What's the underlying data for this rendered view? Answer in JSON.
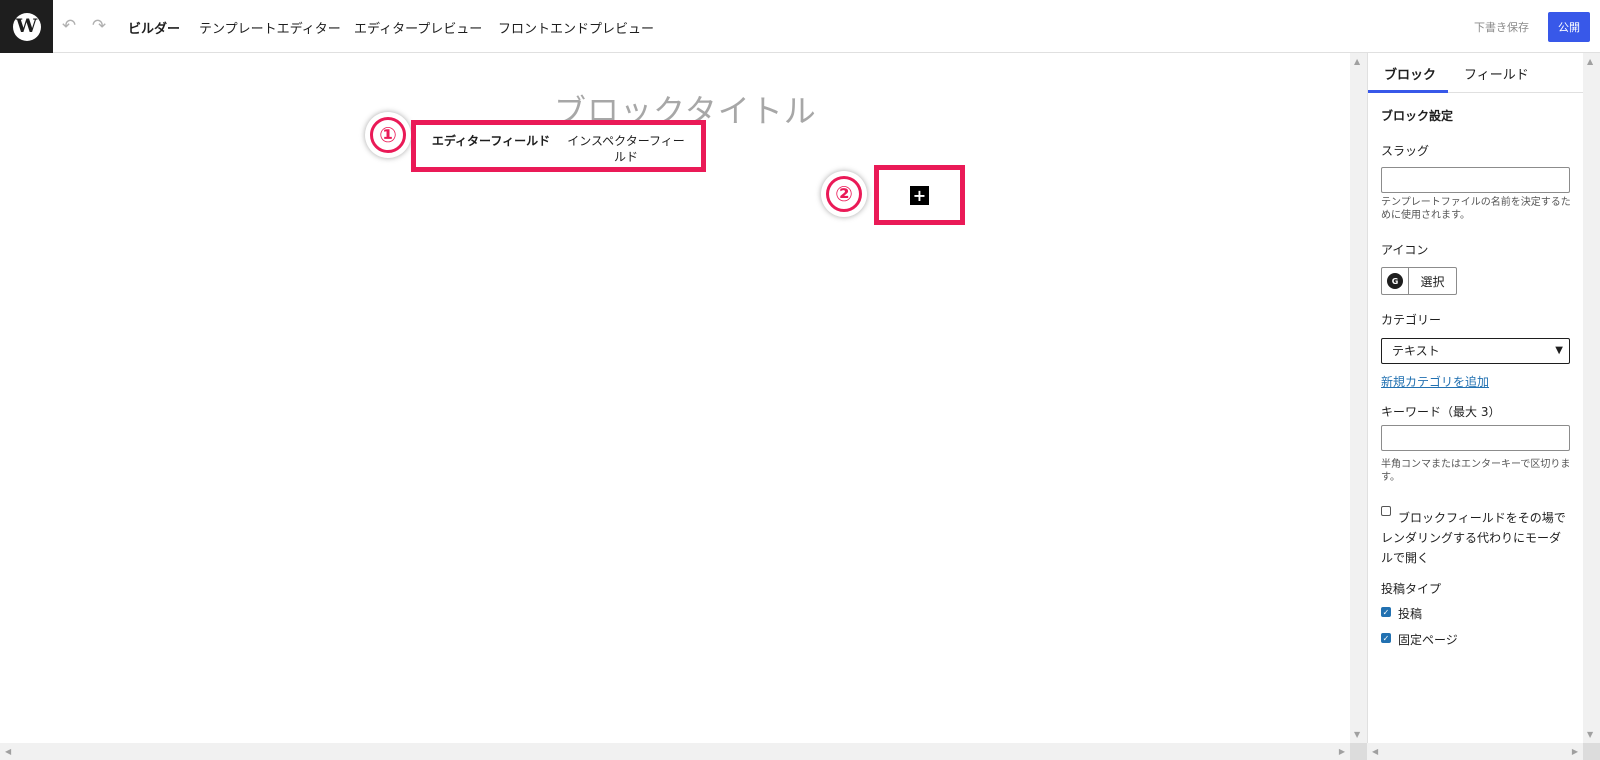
{
  "topbar": {
    "logo": "W",
    "undo_icon": "↶",
    "redo_icon": "↷",
    "nav": [
      {
        "label": "ビルダー"
      },
      {
        "label": "テンプレートエディター"
      },
      {
        "label": "エディタープレビュー"
      },
      {
        "label": "フロントエンドプレビュー"
      }
    ],
    "save_draft": "下書き保存",
    "publish": "公開"
  },
  "canvas": {
    "block_title_placeholder": "ブロックタイトル",
    "tabs": [
      {
        "label": "エディターフィールド"
      },
      {
        "label": "インスペクターフィールド"
      }
    ],
    "add_icon": "+",
    "badges": [
      "①",
      "②"
    ]
  },
  "sidebar": {
    "tabs": [
      {
        "label": "ブロック"
      },
      {
        "label": "フィールド"
      }
    ],
    "section_title": "ブロック設定",
    "slug": {
      "label": "スラッグ",
      "value": "",
      "help": "テンプレートファイルの名前を決定するために使用されます。"
    },
    "icon": {
      "label": "アイコン",
      "icon_glyph": "G",
      "button": "選択"
    },
    "category": {
      "label": "カテゴリー",
      "value": "テキスト",
      "add_link": "新規カテゴリを追加"
    },
    "keywords": {
      "label": "キーワード（最大 3）",
      "value": "",
      "help": "半角コンマまたはエンターキーで区切ります。"
    },
    "modal_option": {
      "label": "ブロックフィールドをその場でレンダリングする代わりにモーダルで開く",
      "checked": false
    },
    "post_types": {
      "label": "投稿タイプ",
      "items": [
        {
          "label": "投稿",
          "checked": true
        },
        {
          "label": "固定ページ",
          "checked": true
        }
      ]
    }
  },
  "colors": {
    "highlight": "#ea1a57",
    "accent": "#3858e9",
    "link": "#2271b1"
  }
}
